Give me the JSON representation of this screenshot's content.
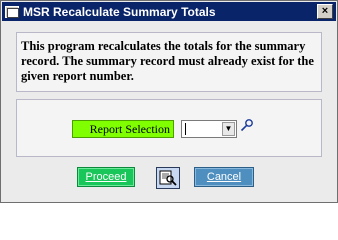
{
  "window": {
    "title": "MSR Recalculate Summary Totals",
    "close_glyph": "×"
  },
  "info": {
    "text": "This program recalculates the totals for the summary record. The summary record must already exist for the given report number."
  },
  "selection": {
    "label": "Report Selection",
    "value": "",
    "dropdown_glyph": "▼"
  },
  "buttons": {
    "proceed": "Proceed",
    "cancel": "Cancel"
  },
  "icons": {
    "app": "window-icon",
    "lookup": "magnifier-lookup-icon",
    "preview": "print-preview-icon"
  },
  "colors": {
    "titlebar": "#0a246a",
    "label_bg": "#7fff00",
    "proceed_bg": "#19c65a",
    "cancel_bg": "#4f8fc0"
  }
}
